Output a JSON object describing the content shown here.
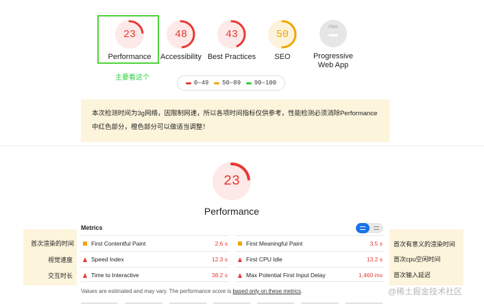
{
  "colors": {
    "fail": "#e53935",
    "average": "#f0a500",
    "pass": "#2ecc40",
    "na": "#9e9e9e"
  },
  "categories": [
    {
      "score": "23",
      "value": 23,
      "label": "Performance",
      "status": "fail"
    },
    {
      "score": "48",
      "value": 48,
      "label": "Accessibility",
      "status": "fail"
    },
    {
      "score": "43",
      "value": 43,
      "label": "Best Practices",
      "status": "fail"
    },
    {
      "score": "50",
      "value": 50,
      "label": "SEO",
      "status": "average"
    },
    {
      "badge": "PWA",
      "label_line1": "Progressive",
      "label_line2": "Web App",
      "status": "na"
    }
  ],
  "note_main": "主要看这个",
  "legend": [
    {
      "label": "0–49",
      "status": "fail"
    },
    {
      "label": "50–89",
      "status": "average"
    },
    {
      "label": "90–100",
      "status": "pass"
    }
  ],
  "notice": {
    "line1": "本次检测时间为3g网络，因限制网速，所以各项时间指标仅供参考，性能检测必须消除Performance",
    "line2": "中红色部分，橙色部分可以做适当调整！"
  },
  "main_gauge": {
    "score": "23",
    "value": 23,
    "label": "Performance"
  },
  "metrics": {
    "title": "Metrics",
    "left": [
      {
        "name": "First Contentful Paint",
        "value": "2.6 s",
        "icon": "square-average-icon"
      },
      {
        "name": "Speed Index",
        "value": "12.3 s",
        "icon": "triangle-fail-icon"
      },
      {
        "name": "Time to Interactive",
        "value": "38.2 s",
        "icon": "triangle-fail-icon"
      }
    ],
    "right": [
      {
        "name": "First Meaningful Paint",
        "value": "3.5 s",
        "icon": "square-average-icon"
      },
      {
        "name": "First CPU Idle",
        "value": "13.2 s",
        "icon": "triangle-fail-icon"
      },
      {
        "name": "Max Potential First Input Delay",
        "value": "1,460 ms",
        "icon": "triangle-fail-icon"
      }
    ],
    "footnote_prefix": "Values are estimated and may vary. The performance score is ",
    "footnote_link": "based only on these metrics",
    "footnote_suffix": "."
  },
  "annotations_left": [
    "首次渲染的时间",
    "视觉速度",
    "交互时长"
  ],
  "annotations_right": [
    "首次有意义的渲染时间",
    "首次cpu空闲时间",
    "首次输入延迟"
  ],
  "watermark": "@稀土掘金技术社区"
}
